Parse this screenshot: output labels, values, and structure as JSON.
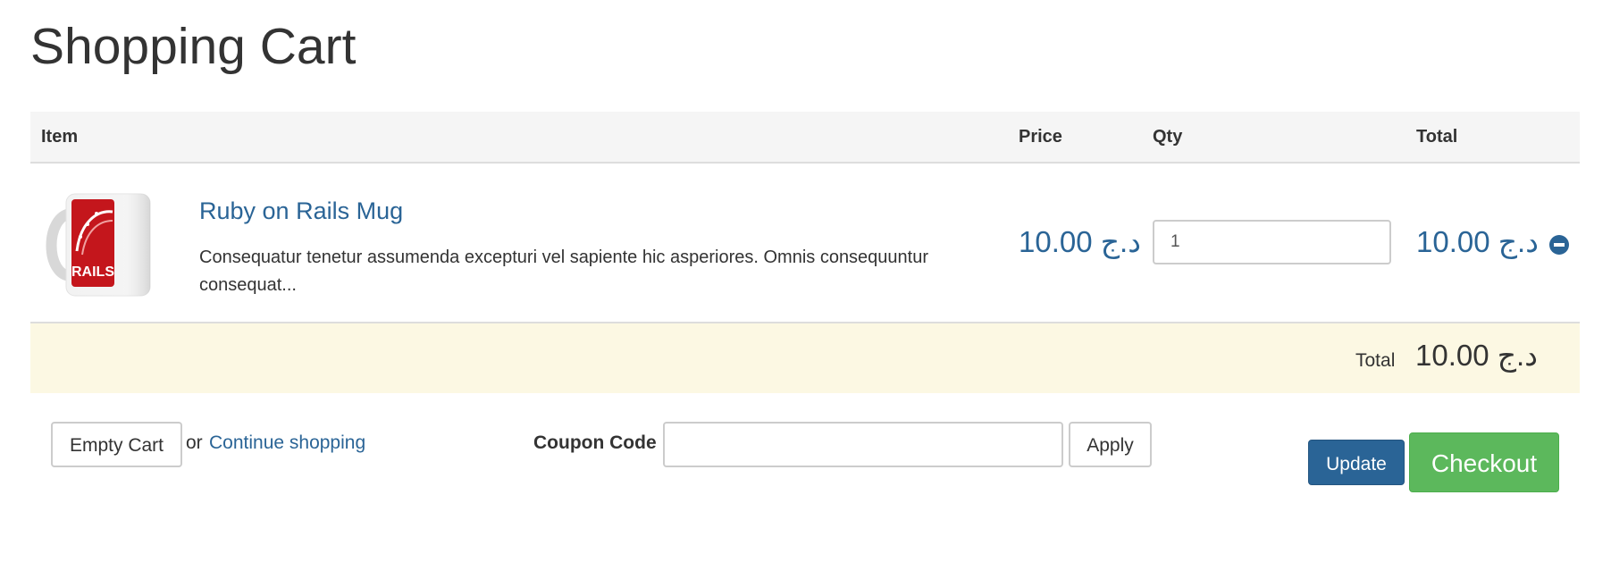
{
  "page": {
    "title": "Shopping Cart"
  },
  "table": {
    "headers": {
      "item": "Item",
      "price": "Price",
      "qty": "Qty",
      "total": "Total"
    },
    "rows": [
      {
        "title": "Ruby on Rails Mug",
        "description": "Consequatur tenetur assumenda excepturi vel sapiente hic asperiores. Omnis consequuntur consequat...",
        "image_label": "RAILS",
        "price": "10.00 د.ج",
        "qty": "1",
        "total": "10.00 د.ج"
      }
    ],
    "total_label": "Total",
    "grand_total": "10.00 د.ج"
  },
  "actions": {
    "empty_cart": "Empty Cart",
    "or_text": "or",
    "continue_shopping": "Continue shopping",
    "coupon_label": "Coupon Code",
    "coupon_value": "",
    "apply": "Apply",
    "update": "Update",
    "checkout": "Checkout"
  },
  "colors": {
    "link": "#2a6496",
    "primary_button": "#2a6496",
    "checkout_button": "#5cb85c",
    "total_row_bg": "#fcf8e3",
    "header_bg": "#f5f5f5"
  },
  "icons": {
    "remove": "minus-circle-icon"
  }
}
